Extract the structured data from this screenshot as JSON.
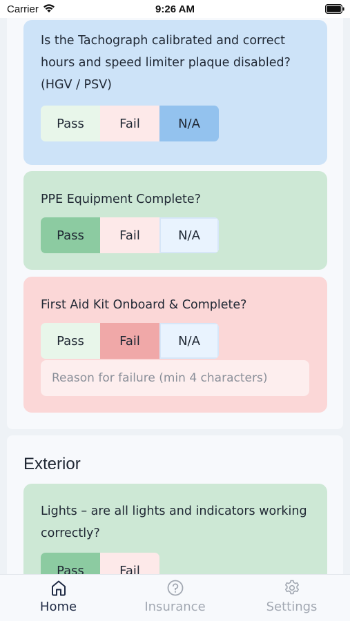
{
  "status_bar": {
    "carrier": "Carrier",
    "time": "9:26 AM"
  },
  "options": {
    "pass": "Pass",
    "fail": "Fail",
    "na": "N/A"
  },
  "checks": [
    {
      "question": "Is the Tachograph calibrated and correct hours and speed limiter plaque disabled? (HGV / PSV)",
      "selected": "N/A"
    },
    {
      "question": "PPE Equipment Complete?",
      "selected": "Pass"
    },
    {
      "question": "First Aid Kit Onboard & Complete?",
      "selected": "Fail",
      "reason_placeholder": "Reason for failure (min 4 characters)",
      "reason_value": ""
    }
  ],
  "exterior": {
    "title": "Exterior",
    "checks": [
      {
        "question": "Lights – are all lights and indicators working correctly?",
        "selected": "Pass"
      }
    ]
  },
  "tab_bar": {
    "active": "Home",
    "tabs": [
      {
        "label": "Home",
        "icon": "home-icon"
      },
      {
        "label": "Insurance",
        "icon": "help-circle-icon"
      },
      {
        "label": "Settings",
        "icon": "gear-icon"
      }
    ]
  },
  "colors": {
    "card_na": "#cde3f8",
    "card_pass": "#cde8d5",
    "card_fail": "#fbd7d7",
    "pass_selected": "#8ccba1",
    "fail_selected": "#f0a8a8",
    "na_selected": "#93c2ee"
  }
}
